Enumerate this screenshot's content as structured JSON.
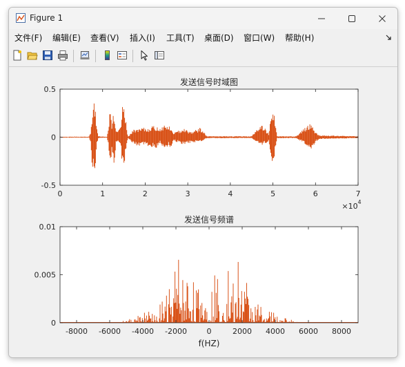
{
  "window": {
    "title": "Figure 1"
  },
  "menu": [
    "文件(F)",
    "编辑(E)",
    "查看(V)",
    "插入(I)",
    "工具(T)",
    "桌面(D)",
    "窗口(W)",
    "帮助(H)"
  ],
  "toolbar": {
    "icons": [
      "new-figure-icon",
      "open-file-icon",
      "save-icon",
      "print-icon",
      "link-plot-icon",
      "insert-colorbar-icon",
      "insert-legend-icon",
      "edit-plot-pointer-icon",
      "show-plot-tools-icon"
    ]
  },
  "colors": {
    "line": "#d95319",
    "axis": "#262626",
    "grid_bg": "#ffffff",
    "figure_bg": "#f0f0f0"
  },
  "chart_data": [
    {
      "type": "line",
      "title": "发送信号时域图",
      "xlabel": "",
      "ylabel": "",
      "xlim": [
        0,
        70000
      ],
      "ylim": [
        -0.5,
        0.5
      ],
      "xticks": [
        "0",
        "1",
        "2",
        "3",
        "4",
        "5",
        "6",
        "7"
      ],
      "yticks": [
        "-0.5",
        "0",
        "0.5"
      ],
      "x_exponent": "×10",
      "x_exponent_power": "4",
      "series": [
        {
          "x": [
            0,
            6800,
            7200,
            7500,
            7800,
            8200,
            8600,
            9000,
            11000,
            11400,
            11800,
            12200,
            12600,
            13200,
            14200,
            14700,
            15200,
            15600,
            16000,
            17500,
            18500,
            19500,
            20500,
            21500,
            22500,
            23500,
            24500,
            25500,
            26000,
            26500,
            27500,
            29000,
            30000,
            31000,
            33000,
            34500,
            45000,
            46500,
            47500,
            49000,
            50000,
            51000,
            55500,
            57500,
            59000,
            60000,
            61000,
            70000
          ],
          "ymax": [
            0.005,
            0.005,
            0.05,
            0.2,
            0.48,
            0.35,
            0.1,
            0.01,
            0.005,
            0.12,
            0.37,
            0.12,
            0.3,
            0.05,
            0.1,
            0.33,
            0.33,
            0.1,
            0.01,
            0.09,
            0.08,
            0.1,
            0.09,
            0.12,
            0.11,
            0.1,
            0.13,
            0.12,
            0.1,
            0.05,
            0.06,
            0.1,
            0.07,
            0.06,
            0.1,
            0.01,
            0.01,
            0.1,
            0.13,
            0.04,
            0.36,
            0.01,
            0.01,
            0.1,
            0.15,
            0.05,
            0.02,
            0.01
          ],
          "ymin": [
            -0.005,
            -0.005,
            -0.05,
            -0.3,
            -0.38,
            -0.45,
            -0.1,
            -0.01,
            -0.005,
            -0.08,
            -0.4,
            -0.15,
            -0.35,
            -0.05,
            -0.08,
            -0.35,
            -0.25,
            -0.1,
            -0.01,
            -0.08,
            -0.1,
            -0.07,
            -0.1,
            -0.1,
            -0.12,
            -0.06,
            -0.12,
            -0.09,
            -0.12,
            -0.04,
            -0.05,
            -0.08,
            -0.06,
            -0.06,
            -0.05,
            -0.01,
            -0.01,
            -0.06,
            -0.08,
            -0.05,
            -0.32,
            -0.01,
            -0.01,
            -0.07,
            -0.13,
            -0.05,
            -0.02,
            -0.01
          ]
        }
      ]
    },
    {
      "type": "line",
      "title": "发送信号频谱",
      "xlabel": "f(HZ)",
      "ylabel": "",
      "xlim": [
        -9000,
        9000
      ],
      "ylim": [
        0,
        0.01
      ],
      "xticks": [
        "-8000",
        "-6000",
        "-4000",
        "-2000",
        "0",
        "2000",
        "4000",
        "6000",
        "8000"
      ],
      "yticks": [
        "0",
        "0.005",
        "0.01"
      ],
      "series": [
        {
          "x": [
            -9000,
            -5500,
            -5000,
            -4500,
            -4000,
            -3500,
            -3000,
            -2700,
            -2500,
            -2200,
            -1800,
            -1500,
            -1300,
            -1000,
            -700,
            -400,
            -100,
            100,
            400,
            700,
            1000,
            1300,
            1500,
            1800,
            2200,
            2500,
            2700,
            3000,
            3500,
            4000,
            4500,
            5000,
            5500,
            9000
          ],
          "ymax": [
            0,
            0,
            0.0003,
            0.0005,
            0.001,
            0.0012,
            0.0018,
            0.0025,
            0.003,
            0.0045,
            0.0068,
            0.0035,
            0.0062,
            0.0045,
            0.003,
            0.0055,
            0.0025,
            0.0025,
            0.0055,
            0.003,
            0.0045,
            0.0062,
            0.0035,
            0.0068,
            0.0045,
            0.003,
            0.0025,
            0.0018,
            0.0012,
            0.001,
            0.0005,
            0.0003,
            0,
            0
          ]
        }
      ]
    }
  ]
}
